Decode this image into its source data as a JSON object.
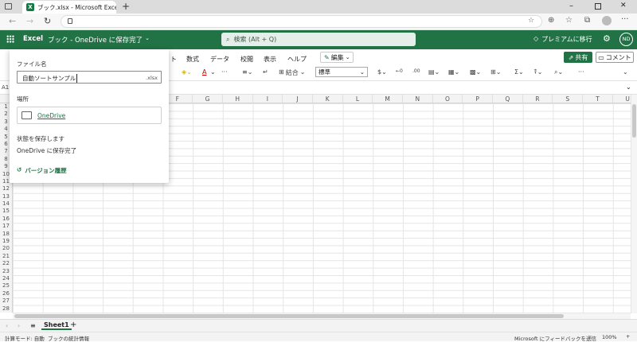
{
  "browser": {
    "tab_title": "ブック.xlsx - Microsoft Excel Online"
  },
  "appbar": {
    "app_name": "Excel",
    "doc_status": "ブック - OneDrive に保存完了",
    "search_placeholder": "検索 (Alt + Q)",
    "premium_label": "プレミアムに移行",
    "avatar_initials": "ND"
  },
  "ribbon": {
    "tabs": [
      "ト",
      "数式",
      "データ",
      "校閲",
      "表示",
      "ヘルプ"
    ],
    "edit_mode": "編集",
    "share_label": "共有",
    "comment_label": "コメント",
    "merge_label": "結合",
    "number_format": "標準"
  },
  "formula_bar": {
    "cell_ref": "A1"
  },
  "grid": {
    "columns": [
      "",
      "",
      "",
      "",
      "",
      "F",
      "G",
      "H",
      "I",
      "J",
      "K",
      "L",
      "M",
      "N",
      "O",
      "P",
      "Q",
      "R",
      "S",
      "T",
      "U"
    ],
    "rows": [
      "1",
      "2",
      "3",
      "4",
      "5",
      "6",
      "7",
      "8",
      "9",
      "10",
      "11",
      "12",
      "13",
      "14",
      "15",
      "16",
      "17",
      "18",
      "19",
      "20",
      "21",
      "22",
      "23",
      "24",
      "25",
      "26",
      "27",
      "28"
    ]
  },
  "flyout": {
    "filename_label": "ファイル名",
    "filename_value": "自動ソートサンプル",
    "extension": ".xlsx",
    "location_label": "場所",
    "location_value": "OneDrive",
    "status_heading": "状態を保存します",
    "status_value": "OneDrive に保存完了",
    "version_history": "バージョン履歴"
  },
  "sheets": {
    "active": "Sheet1"
  },
  "statusbar": {
    "calc_mode": "計算モード: 自動",
    "workbook_stats": "ブックの統計情報",
    "feedback": "Microsoft にフィードバックを送信",
    "zoom": "100%"
  },
  "colors": {
    "excel_green": "#217346",
    "link_green": "#1e7145"
  }
}
